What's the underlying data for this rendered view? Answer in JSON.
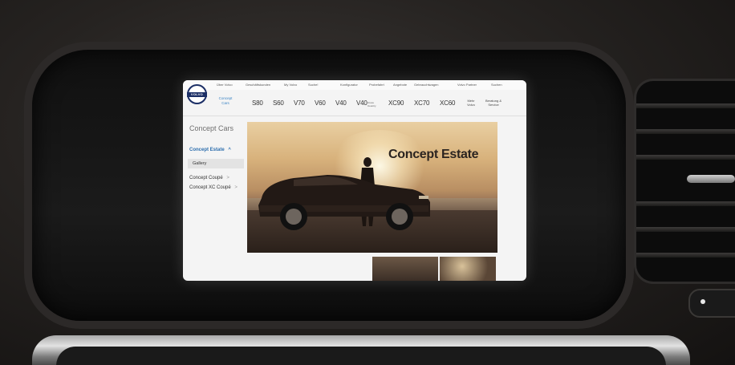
{
  "top_nav": [
    "Über Volvo",
    "Geschäftskunden",
    "My Volvo",
    "Suche!",
    "Konfigurator",
    "Probefahrt",
    "Angebote",
    "Gebrauchtwagen",
    "Volvo Partner",
    "Suchen"
  ],
  "logo_text": "VOLVO",
  "model_bar": {
    "concept_link": "Concept Cars",
    "models": [
      "S80",
      "S60",
      "V70",
      "V60",
      "V40",
      "V40",
      "XC90",
      "XC70",
      "XC60"
    ],
    "v40_sub": "Cross Country",
    "more_volvo": "Mehr Volvo",
    "service": "Beratung & Service"
  },
  "sidebar": {
    "title": "Concept Cars",
    "items": [
      {
        "label": "Concept Estate",
        "chevron": "^"
      },
      {
        "label": "Gallery"
      },
      {
        "label": "Concept Coupé",
        "chevron": ">"
      },
      {
        "label": "Concept XC Coupé",
        "chevron": ">"
      }
    ]
  },
  "hero": {
    "title": "Concept Estate"
  },
  "colors": {
    "accent": "#3a83c4",
    "active_link": "#2e6fae",
    "logo_blue": "#1c2f66"
  }
}
